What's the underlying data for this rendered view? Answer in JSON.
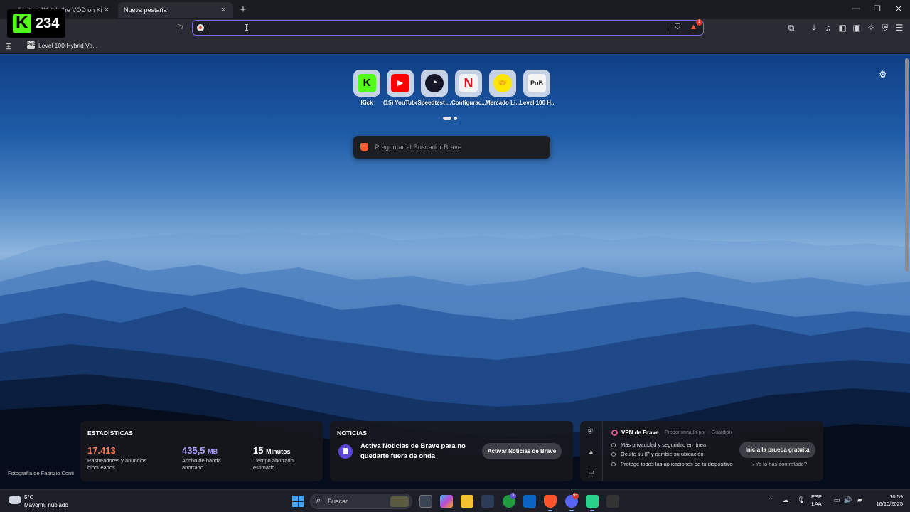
{
  "tabs": [
    {
      "title": "ljanter - Watch the VOD on Kick",
      "close": "×"
    },
    {
      "title": "Nueva pestaña",
      "close": "×"
    }
  ],
  "new_tab_symbol": "+",
  "window_controls": {
    "minimize": "—",
    "maximize": "❐",
    "close": "✕"
  },
  "address_bar": {
    "value": "",
    "placeholder": "",
    "rewards_badge": "1"
  },
  "bookmarks_bar": {
    "apps_icon": "apps-grid-icon",
    "items": [
      {
        "label": "Level 100 Hybrid Vo...",
        "favicon": "PoB"
      }
    ]
  },
  "kick_overlay": {
    "count": "234"
  },
  "top_sites": [
    {
      "label": "Kick",
      "glyph": "K",
      "bg": "#53fc18",
      "fg": "#000000"
    },
    {
      "label": "(15) YouTube",
      "glyph": "▶",
      "bg": "#ff0000",
      "fg": "#ffffff"
    },
    {
      "label": "Speedtest ...",
      "glyph": "◔",
      "bg": "#141526",
      "fg": "#ffffff"
    },
    {
      "label": "Configurac...",
      "glyph": "N",
      "bg": "#f3f3f3",
      "fg": "#e50914"
    },
    {
      "label": "Mercado Li...",
      "glyph": "🤝",
      "bg": "#ffe600",
      "fg": "#2d3277"
    },
    {
      "label": "Level 100 H...",
      "glyph": "PoB",
      "bg": "#f4f4f4",
      "fg": "#222222"
    }
  ],
  "search": {
    "placeholder": "Preguntar al Buscador Brave"
  },
  "photo_credit": "Fotografía de Fabrizio Conti",
  "stats": {
    "title": "ESTADÍSTICAS",
    "items": [
      {
        "value": "17.413",
        "unit": "",
        "desc1": "Rastreadores y anuncios",
        "desc2": "bloqueados",
        "color": "#ff7a55"
      },
      {
        "value": "435,5",
        "unit": "MB",
        "desc1": "Ancho de banda",
        "desc2": "ahorrado",
        "color": "#a89cf4"
      },
      {
        "value": "15",
        "unit": "Minutos",
        "desc1": "Tiempo ahorrado",
        "desc2": "estimado",
        "color": "#ffffff"
      }
    ]
  },
  "news": {
    "title": "NOTICIAS",
    "text": "Activa Noticias de Brave para no quedarte fuera de onda",
    "button": "Activar Noticias de Brave"
  },
  "vpn": {
    "title": "VPN de Brave",
    "provided_by": "Proporcionado por ◌ Guardian",
    "features": [
      "Más privacidad y seguridad en línea",
      "Oculte su IP y cambie su ubicación",
      "Protege todas las aplicaciones de tu dispositivo"
    ],
    "button": "Inicia la prueba gratuita",
    "link": "¿Ya lo has contratado?"
  },
  "taskbar": {
    "weather_temp": "5°C",
    "weather_desc": "Mayorm. nublado",
    "search_label": "Buscar",
    "xbox_badge": "3",
    "discord_badge": "9+",
    "lang_top": "ESP",
    "lang_bottom": "LAA",
    "time": "10:59",
    "date": "16/10/2025"
  }
}
